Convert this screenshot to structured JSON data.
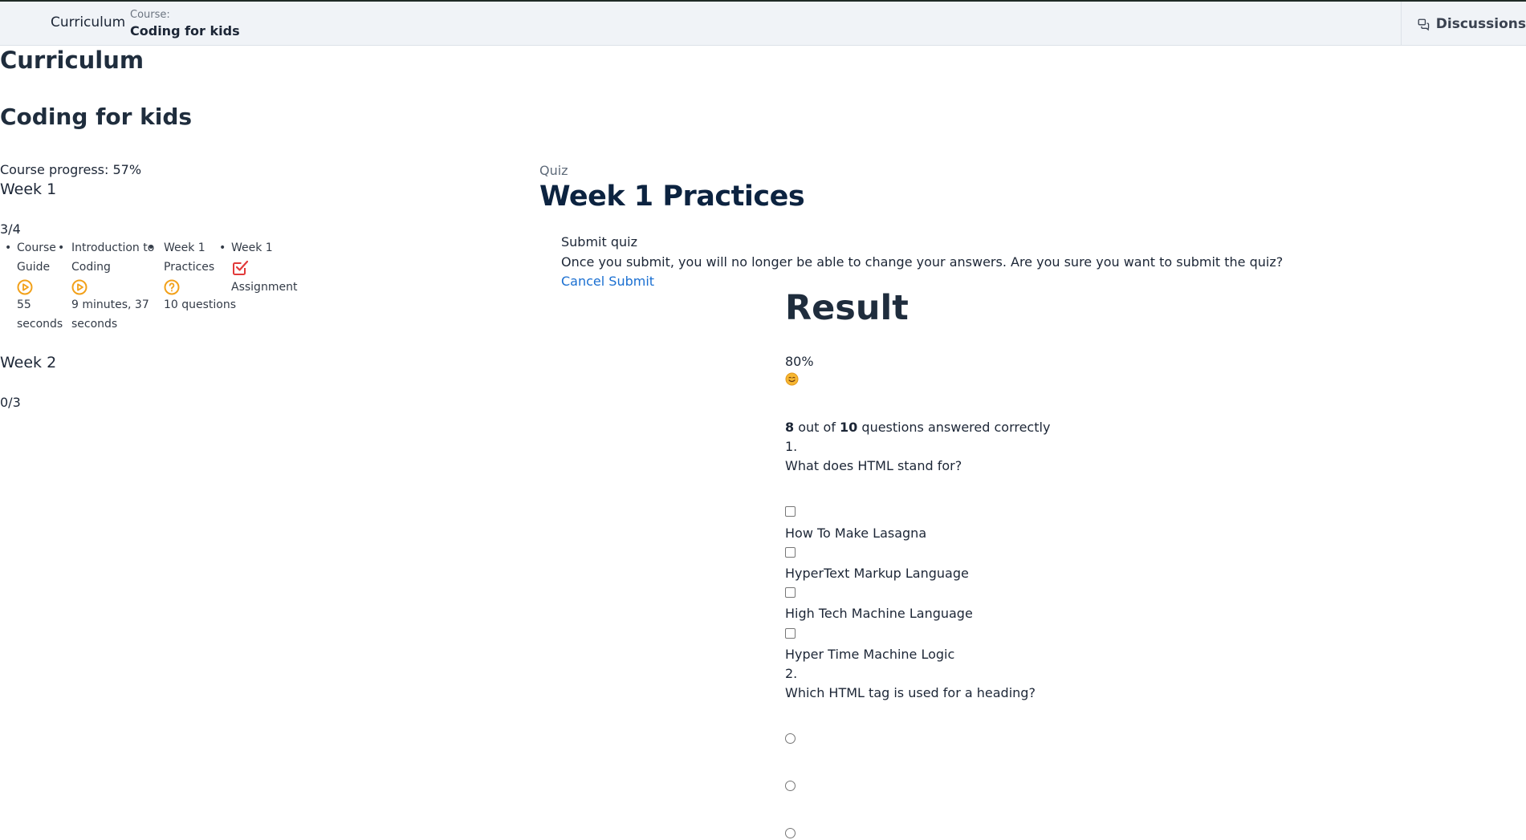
{
  "topbar": {
    "curriculum_label": "Curriculum",
    "course_prefix": "Course:",
    "course_name": "Coding for kids",
    "discussions_label": "Discussions"
  },
  "sidebar": {
    "heading": "Curriculum",
    "course_title": "Coding for kids",
    "progress_label": "Course progress: 57%",
    "progress_percent": 57,
    "weeks": [
      {
        "title": "Week 1",
        "count": "3/4",
        "lessons": [
          {
            "line1": "Course",
            "line2": "Guide",
            "icon": "play-circle-icon",
            "meta1": "55",
            "meta2": "seconds"
          },
          {
            "line1": "Introduction to",
            "line2": "Coding",
            "icon": "play-circle-icon",
            "meta1": "9 minutes, 37",
            "meta2": "seconds"
          },
          {
            "line1": "Week 1",
            "line2": "Practices",
            "icon": "question-circle-icon",
            "meta1": "10 questions"
          },
          {
            "line1": "Week 1",
            "line2": "Assignment",
            "icon": "checked-assignment-icon"
          }
        ]
      },
      {
        "title": "Week 2",
        "count": "0/3"
      }
    ]
  },
  "quiz": {
    "kind": "Quiz",
    "title": "Week 1 Practices",
    "submit": {
      "title": "Submit quiz",
      "confirm": "Once you submit, you will no longer be able to change your answers. Are you sure you want to submit the quiz?",
      "actions_label": "Cancel Submit"
    },
    "result": {
      "heading": "Result",
      "score": "80%",
      "emoji": "😊",
      "correct_num": "8",
      "out_of_text": "out of",
      "total_num": "10",
      "suffix": "questions answered correctly"
    },
    "questions": [
      {
        "number": "1.",
        "text": "What does HTML stand for?",
        "options": [
          "How To Make Lasagna",
          "HyperText Markup Language",
          "High Tech Machine Language",
          "Hyper Time Machine Logic"
        ]
      },
      {
        "number": "2.",
        "text": "Which HTML tag is used for a heading?"
      }
    ]
  },
  "colors": {
    "accent_orange": "#f2a11a",
    "assignment_red": "#e23a3a",
    "link_blue": "#1a6fd1",
    "title_navy": "#0c2340"
  }
}
